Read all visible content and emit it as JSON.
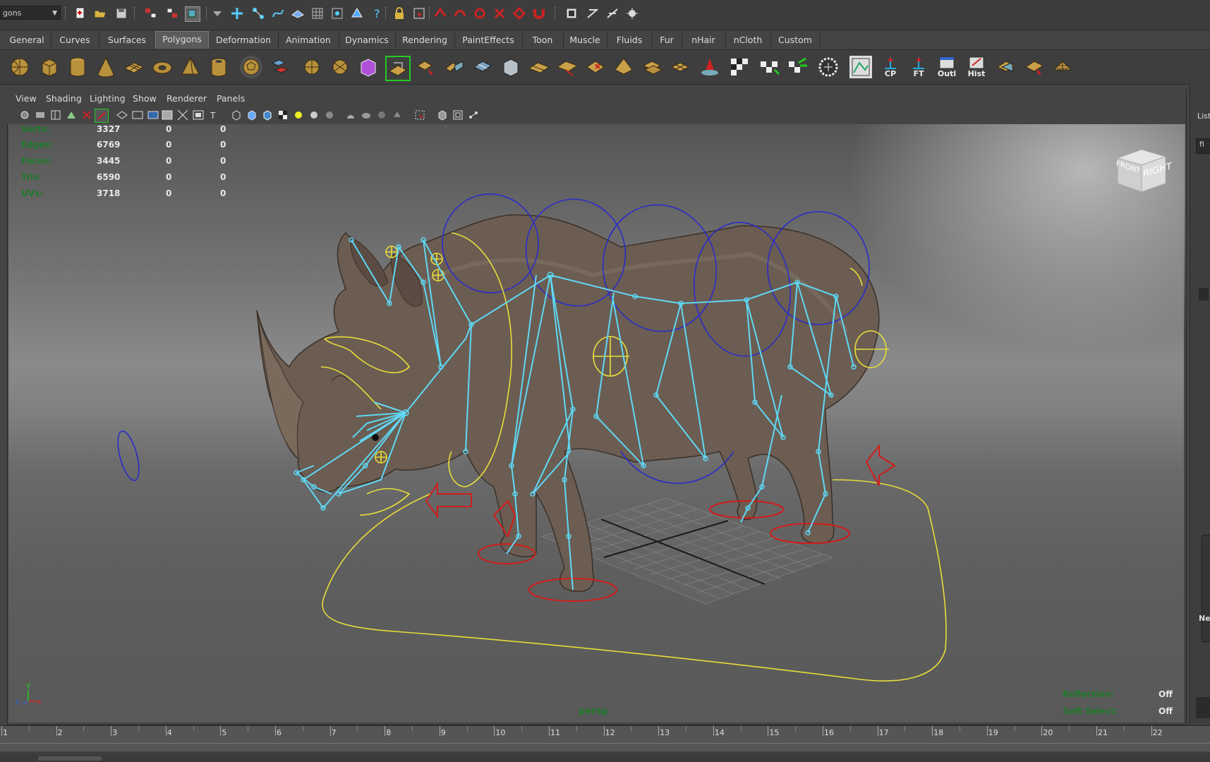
{
  "statusline": {
    "mode_value": "gons"
  },
  "shelf_tabs": [
    "General",
    "Curves",
    "Surfaces",
    "Polygons",
    "Deformation",
    "Animation",
    "Dynamics",
    "Rendering",
    "PaintEffects",
    "Toon",
    "Muscle",
    "Fluids",
    "Fur",
    "nHair",
    "nCloth",
    "Custom"
  ],
  "active_tab": "Polygons",
  "shelf_labels": {
    "cp": "CP",
    "ft": "FT",
    "outl": "Outl",
    "hist": "Hist"
  },
  "panel_menu": [
    "View",
    "Shading",
    "Lighting",
    "Show",
    "Renderer",
    "Panels"
  ],
  "hud_stats": [
    {
      "label": "Verts:",
      "v1": "3327",
      "v2": "0",
      "v3": "0"
    },
    {
      "label": "Edges:",
      "v1": "6769",
      "v2": "0",
      "v3": "0"
    },
    {
      "label": "Faces:",
      "v1": "3445",
      "v2": "0",
      "v3": "0"
    },
    {
      "label": "Tris:",
      "v1": "6590",
      "v2": "0",
      "v3": "0"
    },
    {
      "label": "UVs:",
      "v1": "3718",
      "v2": "0",
      "v3": "0"
    }
  ],
  "viewport": {
    "camera_name": "persp",
    "viewcube_front": "FRONT",
    "viewcube_right": "RIGHT",
    "axis_y": "y",
    "axis_z": "z",
    "axis_x": "x",
    "reflection_label": "Reflection:",
    "reflection_value": "Off",
    "soft_select_label": "Soft Select:",
    "soft_select_value": "Off"
  },
  "right_panel": {
    "list_label": "List",
    "f_label": "fi",
    "ne_label": "Ne"
  },
  "timeline": {
    "frames": [
      "1",
      "2",
      "3",
      "4",
      "5",
      "6",
      "7",
      "8",
      "9",
      "10",
      "11",
      "12",
      "13",
      "14",
      "15",
      "16",
      "17",
      "18",
      "19",
      "20",
      "21",
      "22"
    ]
  },
  "colors": {
    "skeleton": "#5fd8f5",
    "control_yellow": "#e8dd3a",
    "control_blue": "#2c2cc8",
    "control_red": "#d21c1c",
    "hud_green": "#1f7a2a"
  }
}
